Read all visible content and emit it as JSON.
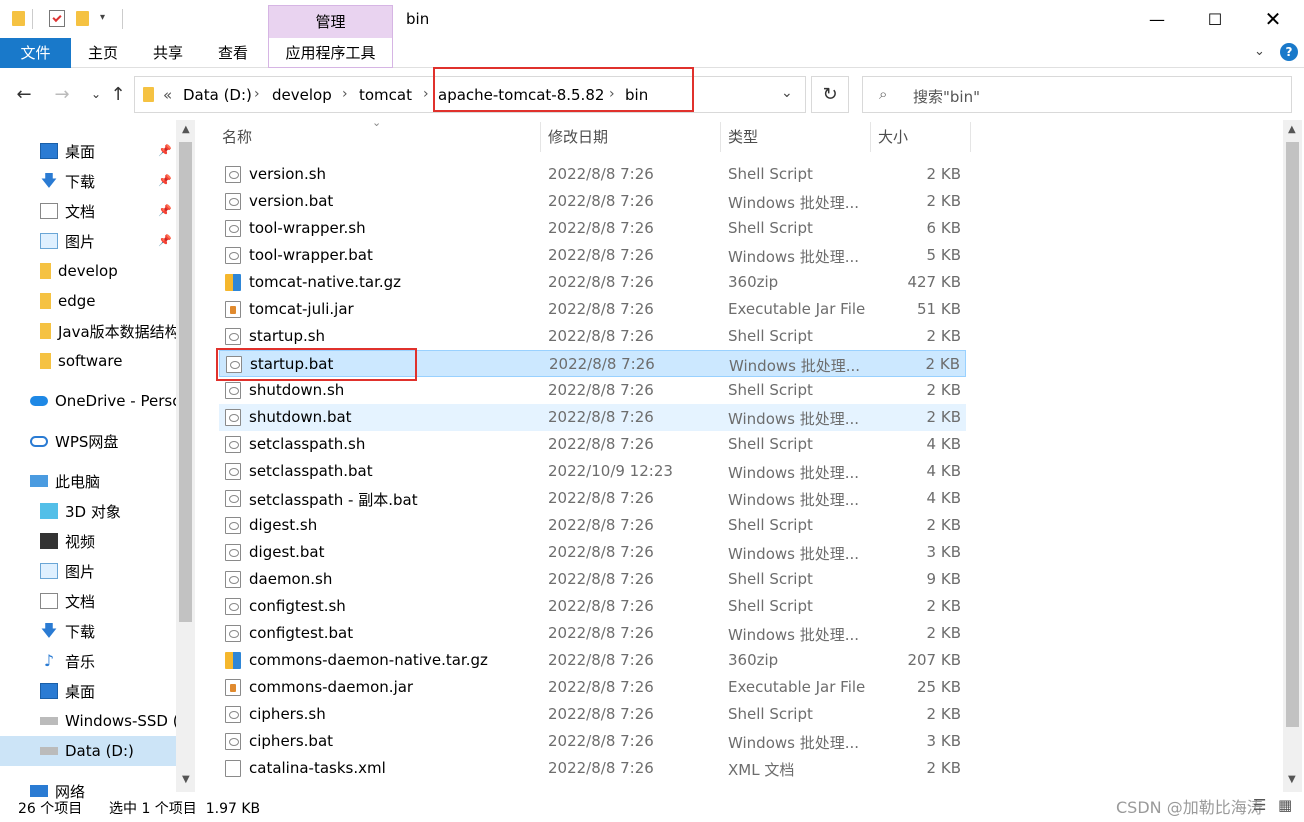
{
  "window": {
    "title": "bin",
    "context_tab": "管理",
    "minimize_icon": "minimize-icon",
    "maximize_icon": "maximize-icon",
    "close_icon": "close-icon"
  },
  "ribbon": {
    "tabs": [
      "文件",
      "主页",
      "共享",
      "查看",
      "应用程序工具"
    ],
    "file_color": "#1979ca",
    "context_color": "#e9d3f0"
  },
  "address": {
    "overflow": "«",
    "crumbs": [
      "Data (D:)",
      "develop",
      "tomcat",
      "apache-tomcat-8.5.82",
      "bin"
    ],
    "search_placeholder": "搜索\"bin\""
  },
  "sidebar": {
    "items": [
      {
        "label": "桌面",
        "icon": "desktop-icon",
        "pinned": true
      },
      {
        "label": "下载",
        "icon": "download-icon",
        "pinned": true
      },
      {
        "label": "文档",
        "icon": "document-icon",
        "pinned": true
      },
      {
        "label": "图片",
        "icon": "picture-icon",
        "pinned": true
      },
      {
        "label": "develop",
        "icon": "folder-icon"
      },
      {
        "label": "edge",
        "icon": "folder-icon"
      },
      {
        "label": "Java版本数据结构",
        "icon": "folder-icon"
      },
      {
        "label": "software",
        "icon": "folder-icon"
      },
      {
        "label": "OneDrive - Personal",
        "icon": "onedrive-icon"
      },
      {
        "label": "WPS网盘",
        "icon": "cloud-icon"
      },
      {
        "label": "此电脑",
        "icon": "computer-icon"
      },
      {
        "label": "3D 对象",
        "icon": "cube-icon"
      },
      {
        "label": "视频",
        "icon": "video-icon"
      },
      {
        "label": "图片",
        "icon": "picture-icon"
      },
      {
        "label": "文档",
        "icon": "document-icon"
      },
      {
        "label": "下载",
        "icon": "download-icon"
      },
      {
        "label": "音乐",
        "icon": "music-icon"
      },
      {
        "label": "桌面",
        "icon": "desktop-icon"
      },
      {
        "label": "Windows-SSD (C:)",
        "icon": "drive-icon"
      },
      {
        "label": "Data (D:)",
        "icon": "drive-icon",
        "selected": true
      },
      {
        "label": "网络",
        "icon": "network-icon"
      }
    ]
  },
  "columns": [
    "名称",
    "修改日期",
    "类型",
    "大小"
  ],
  "files": [
    {
      "name": "version.sh",
      "date": "2022/8/8 7:26",
      "type": "Shell Script",
      "size": "2 KB",
      "icon": "sh"
    },
    {
      "name": "version.bat",
      "date": "2022/8/8 7:26",
      "type": "Windows 批处理...",
      "size": "2 KB",
      "icon": "sh"
    },
    {
      "name": "tool-wrapper.sh",
      "date": "2022/8/8 7:26",
      "type": "Shell Script",
      "size": "6 KB",
      "icon": "sh"
    },
    {
      "name": "tool-wrapper.bat",
      "date": "2022/8/8 7:26",
      "type": "Windows 批处理...",
      "size": "5 KB",
      "icon": "sh"
    },
    {
      "name": "tomcat-native.tar.gz",
      "date": "2022/8/8 7:26",
      "type": "360zip",
      "size": "427 KB",
      "icon": "zip"
    },
    {
      "name": "tomcat-juli.jar",
      "date": "2022/8/8 7:26",
      "type": "Executable Jar File",
      "size": "51 KB",
      "icon": "jar"
    },
    {
      "name": "startup.sh",
      "date": "2022/8/8 7:26",
      "type": "Shell Script",
      "size": "2 KB",
      "icon": "sh"
    },
    {
      "name": "startup.bat",
      "date": "2022/8/8 7:26",
      "type": "Windows 批处理...",
      "size": "2 KB",
      "icon": "sh",
      "selected": true
    },
    {
      "name": "shutdown.sh",
      "date": "2022/8/8 7:26",
      "type": "Shell Script",
      "size": "2 KB",
      "icon": "sh"
    },
    {
      "name": "shutdown.bat",
      "date": "2022/8/8 7:26",
      "type": "Windows 批处理...",
      "size": "2 KB",
      "icon": "sh",
      "hover": true
    },
    {
      "name": "setclasspath.sh",
      "date": "2022/8/8 7:26",
      "type": "Shell Script",
      "size": "4 KB",
      "icon": "sh"
    },
    {
      "name": "setclasspath.bat",
      "date": "2022/10/9 12:23",
      "type": "Windows 批处理...",
      "size": "4 KB",
      "icon": "sh"
    },
    {
      "name": "setclasspath - 副本.bat",
      "date": "2022/8/8 7:26",
      "type": "Windows 批处理...",
      "size": "4 KB",
      "icon": "sh"
    },
    {
      "name": "digest.sh",
      "date": "2022/8/8 7:26",
      "type": "Shell Script",
      "size": "2 KB",
      "icon": "sh"
    },
    {
      "name": "digest.bat",
      "date": "2022/8/8 7:26",
      "type": "Windows 批处理...",
      "size": "3 KB",
      "icon": "sh"
    },
    {
      "name": "daemon.sh",
      "date": "2022/8/8 7:26",
      "type": "Shell Script",
      "size": "9 KB",
      "icon": "sh"
    },
    {
      "name": "configtest.sh",
      "date": "2022/8/8 7:26",
      "type": "Shell Script",
      "size": "2 KB",
      "icon": "sh"
    },
    {
      "name": "configtest.bat",
      "date": "2022/8/8 7:26",
      "type": "Windows 批处理...",
      "size": "2 KB",
      "icon": "sh"
    },
    {
      "name": "commons-daemon-native.tar.gz",
      "date": "2022/8/8 7:26",
      "type": "360zip",
      "size": "207 KB",
      "icon": "zip"
    },
    {
      "name": "commons-daemon.jar",
      "date": "2022/8/8 7:26",
      "type": "Executable Jar File",
      "size": "25 KB",
      "icon": "jar"
    },
    {
      "name": "ciphers.sh",
      "date": "2022/8/8 7:26",
      "type": "Shell Script",
      "size": "2 KB",
      "icon": "sh"
    },
    {
      "name": "ciphers.bat",
      "date": "2022/8/8 7:26",
      "type": "Windows 批处理...",
      "size": "3 KB",
      "icon": "sh"
    },
    {
      "name": "catalina-tasks.xml",
      "date": "2022/8/8 7:26",
      "type": "XML 文档",
      "size": "2 KB",
      "icon": "xml"
    }
  ],
  "status": {
    "count": "26 个项目",
    "selection": "选中 1 个项目  1.97 KB"
  },
  "watermark": "CSDN @加勒比海涛"
}
